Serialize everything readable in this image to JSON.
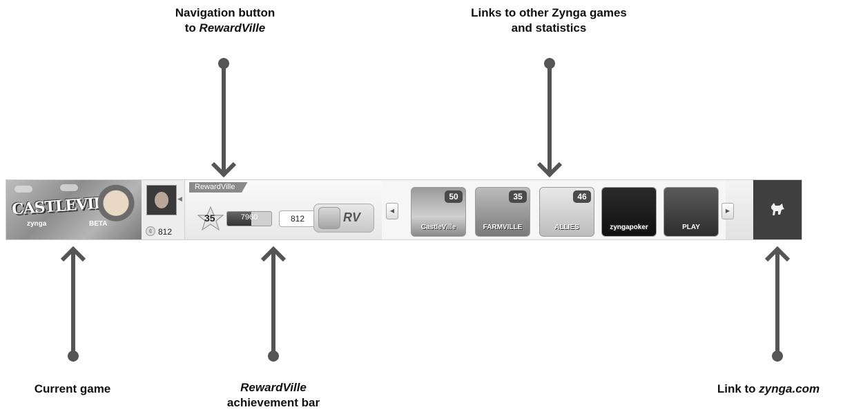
{
  "callouts": {
    "nav_button": {
      "line1": "Navigation button",
      "line2_prefix": "to ",
      "line2_italic": "RewardVille"
    },
    "other_games": {
      "line1": "Links to other Zynga games",
      "line2": "and statistics"
    },
    "current_game": {
      "text": "Current game"
    },
    "achievement_bar": {
      "line1_italic": "RewardVille",
      "line2": "achievement bar"
    },
    "zynga_link": {
      "prefix": "Link to ",
      "italic": "zynga.com"
    }
  },
  "toolbar": {
    "current_game": {
      "title": "CASTLEVILLE",
      "sub": "zynga",
      "badge": "BETA"
    },
    "profile": {
      "coins": "812",
      "collapse_glyph": "◀"
    },
    "rewardville": {
      "tab_label": "RewardVille",
      "level": "35",
      "xp": "7960",
      "xp_fraction": 0.55,
      "coins": "812",
      "logo_text": "RV"
    },
    "games": {
      "prev_glyph": "◀",
      "next_glyph": "▶",
      "tiles": [
        {
          "label": "CastleVille",
          "badge": "50",
          "icon": "castleville-game-icon"
        },
        {
          "label": "FARMVILLE",
          "badge": "35",
          "icon": "farmville-game-icon"
        },
        {
          "label": "ALLIES",
          "badge": "46",
          "icon": "empires-allies-game-icon"
        },
        {
          "label": "zyngapoker",
          "badge": "",
          "icon": "zynga-poker-game-icon"
        },
        {
          "label": "PLAY",
          "badge": "",
          "icon": "words-with-friends-game-icon"
        }
      ]
    },
    "zynga": {
      "icon": "zynga-dog-icon"
    }
  },
  "colors": {
    "pointer": "#555555",
    "zynga_bg": "#3f3f3f",
    "badge": "#4a4a4a"
  }
}
